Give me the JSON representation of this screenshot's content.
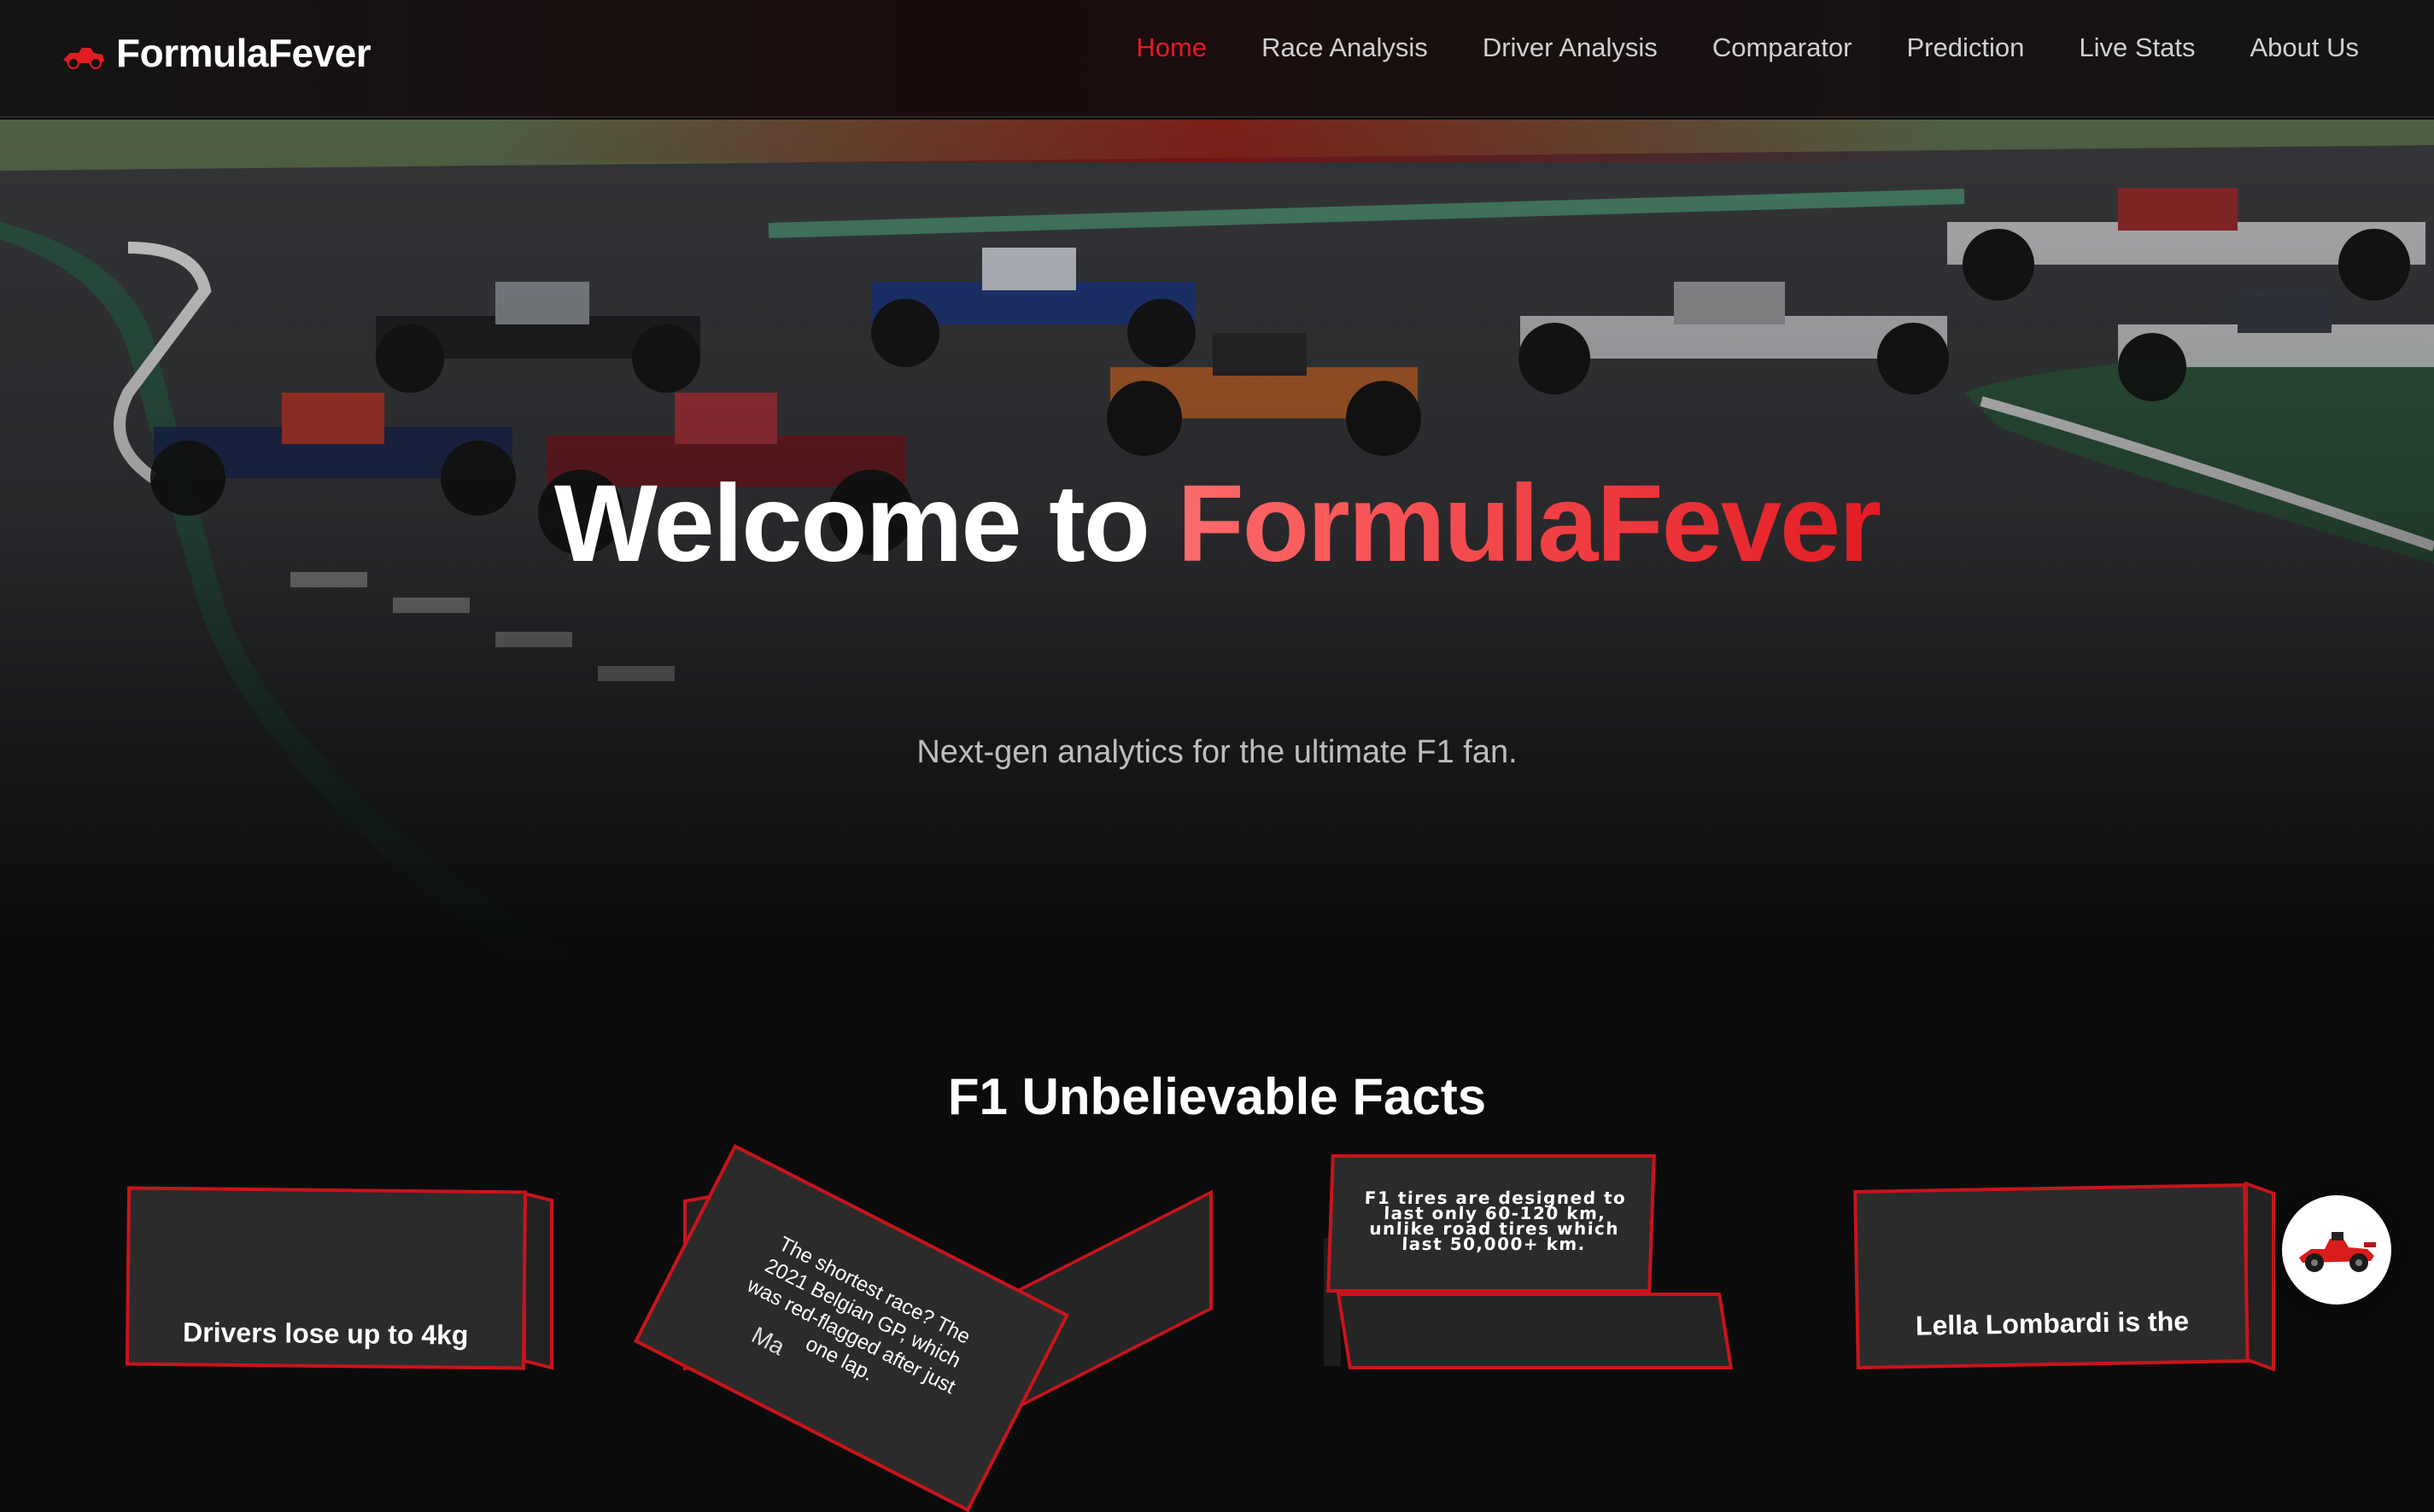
{
  "brand": {
    "name": "FormulaFever",
    "icon": "race-car-icon"
  },
  "nav": {
    "items": [
      {
        "label": "Home",
        "active": true
      },
      {
        "label": "Race Analysis",
        "active": false
      },
      {
        "label": "Driver Analysis",
        "active": false
      },
      {
        "label": "Comparator",
        "active": false
      },
      {
        "label": "Prediction",
        "active": false
      },
      {
        "label": "Live Stats",
        "active": false
      },
      {
        "label": "About Us",
        "active": false
      }
    ]
  },
  "hero": {
    "title_prefix": "Welcome to ",
    "title_accent": "FormulaFever",
    "subtitle": "Next-gen analytics for the ultimate F1 fan."
  },
  "facts": {
    "title": "F1 Unbelievable Facts",
    "cards": [
      {
        "text": "Drivers lose up to 4kg"
      },
      {
        "text": "The shortest race? The 2021 Belgian GP, which was red-flagged after just one lap.",
        "peek": "Ma"
      },
      {
        "text": "F1 tires are designed to last only 60-120 km, unlike road tires which last 50,000+ km."
      },
      {
        "text": "Lella Lombardi is the"
      }
    ]
  },
  "colors": {
    "accent": "#e31b23",
    "background": "#0b0b0c",
    "card_border": "#c8141c"
  },
  "chat": {
    "icon": "f1-car-avatar-icon"
  }
}
